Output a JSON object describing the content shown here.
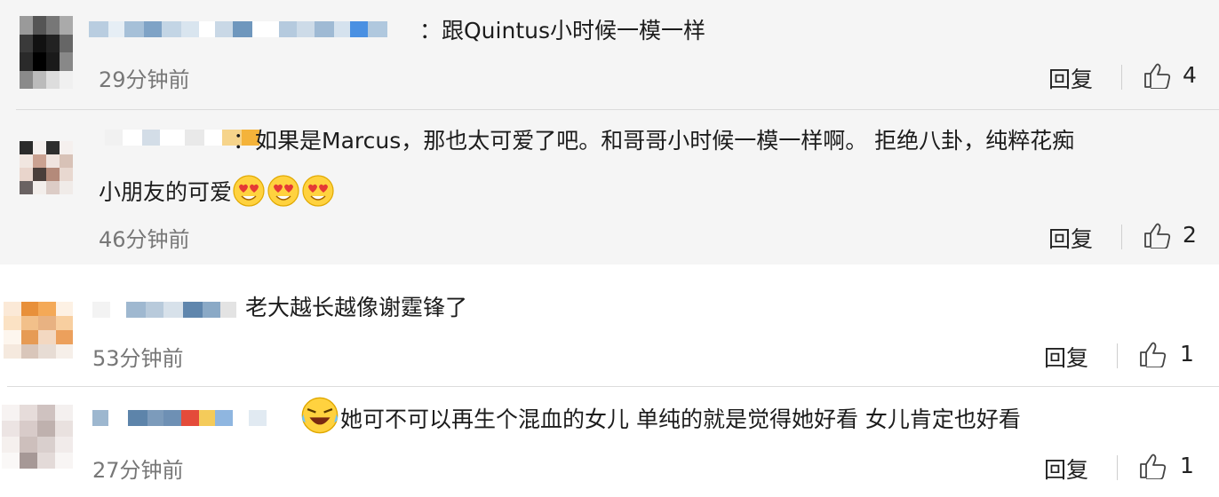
{
  "colors": {
    "panel_top": "#f5f5f5",
    "text": "#1c1c1c",
    "meta": "#777777",
    "pixel_blue": "#7fa3c6",
    "pixel_light": "#c9d8e6"
  },
  "comments": [
    {
      "text_lead": "：跟Quintus小时候一模一样",
      "time": "29分钟前",
      "reply_label": "回复",
      "like_icon": "thumbs-up-icon",
      "likes": "4"
    },
    {
      "text_lead": "：如果是Marcus，那也太可爱了吧。和哥哥小时候一模一样啊。 拒绝八卦，纯粹花痴",
      "text_line2": "小朋友的可爱",
      "emoji": [
        "heart-eyes-emoji",
        "heart-eyes-emoji",
        "heart-eyes-emoji"
      ],
      "time": "46分钟前",
      "reply_label": "回复",
      "like_icon": "thumbs-up-icon",
      "likes": "2"
    },
    {
      "text_lead": "老大越长越像谢霆锋了",
      "time": "53分钟前",
      "reply_label": "回复",
      "like_icon": "thumbs-up-icon",
      "likes": "1"
    },
    {
      "emoji": [
        "laugh-cry-emoji"
      ],
      "text_lead": "她可不可以再生个混血的女儿 单纯的就是觉得她好看 女儿肯定也好看",
      "time": "27分钟前",
      "reply_label": "回复",
      "like_icon": "thumbs-up-icon",
      "likes": "1"
    }
  ]
}
